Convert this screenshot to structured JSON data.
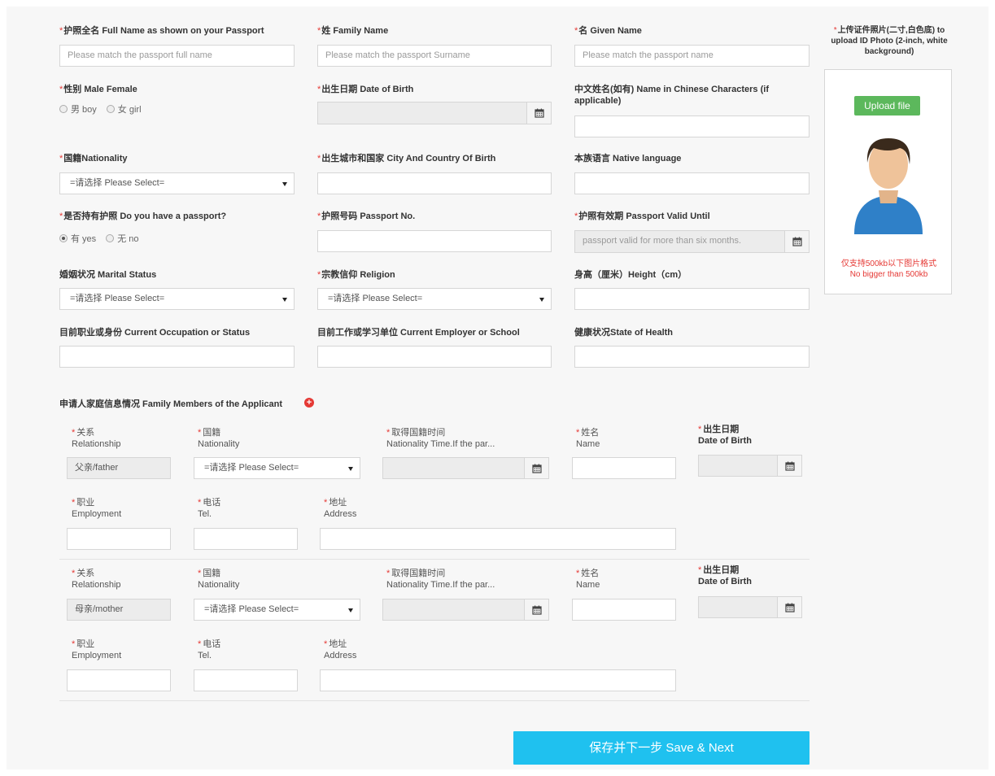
{
  "form": {
    "full_name_label": "护照全名 Full Name as shown on your Passport",
    "full_name_placeholder": "Please match the passport full name",
    "family_name_label": "姓 Family Name",
    "family_name_placeholder": "Please match the passport Surname",
    "given_name_label": "名 Given Name",
    "given_name_placeholder": "Please match the passport name",
    "gender_label": "性别 Male Female",
    "gender_options": [
      "男 boy",
      "女 girl"
    ],
    "dob_label": "出生日期 Date of Birth",
    "chinese_name_label": "中文姓名(如有) Name in Chinese Characters (if applicable)",
    "nationality_label": "国籍Nationality",
    "nationality_value": "=请选择 Please Select=",
    "birth_city_label": "出生城市和国家 City And Country Of Birth",
    "native_language_label": "本族语言 Native language",
    "has_passport_label": "是否持有护照 Do you have a passport?",
    "has_passport_options": [
      "有 yes",
      "无 no"
    ],
    "passport_no_label": "护照号码 Passport No.",
    "passport_valid_label": "护照有效期 Passport Valid Until",
    "passport_valid_placeholder": "passport valid for more than six months.",
    "marital_label": "婚姻状况 Marital Status",
    "marital_value": "=请选择 Please Select=",
    "religion_label": "宗教信仰 Religion",
    "religion_value": "=请选择 Please Select=",
    "height_label": "身高（厘米）Height（cm）",
    "occupation_label": "目前职业或身份 Current Occupation or Status",
    "employer_label": "目前工作或学习单位 Current Employer or School",
    "health_label": "健康状况State of Health"
  },
  "photo": {
    "label": "上传证件照片(二寸,白色底) to upload ID Photo (2-inch, white background)",
    "upload_button": "Upload file",
    "note_cn": "仅支持500kb以下图片格式",
    "note_en": "No bigger than 500kb"
  },
  "family": {
    "title": "申请人家庭信息情况 Family Members of the Applicant",
    "add_icon": "plus-circle-icon",
    "labels": {
      "relationship_cn": "关系",
      "relationship_en": "Relationship",
      "nationality_cn": "国籍",
      "nationality_en": "Nationality",
      "nat_time_cn": "取得国籍时间",
      "nat_time_en": "Nationality Time.If the par...",
      "name_cn": "姓名",
      "name_en": "Name",
      "dob_cn": "出生日期",
      "dob_en": "Date of Birth",
      "employment_cn": "职业",
      "employment_en": "Employment",
      "tel_cn": "电话",
      "tel_en": "Tel.",
      "address_cn": "地址",
      "address_en": "Address"
    },
    "members": [
      {
        "relationship": "父亲/father",
        "nationality": "=请选择 Please Select="
      },
      {
        "relationship": "母亲/mother",
        "nationality": "=请选择 Please Select="
      }
    ]
  },
  "save_button": "保存并下一步 Save & Next",
  "colors": {
    "required": "#e53935",
    "save": "#1fc1ef",
    "upload": "#5cb85c"
  }
}
